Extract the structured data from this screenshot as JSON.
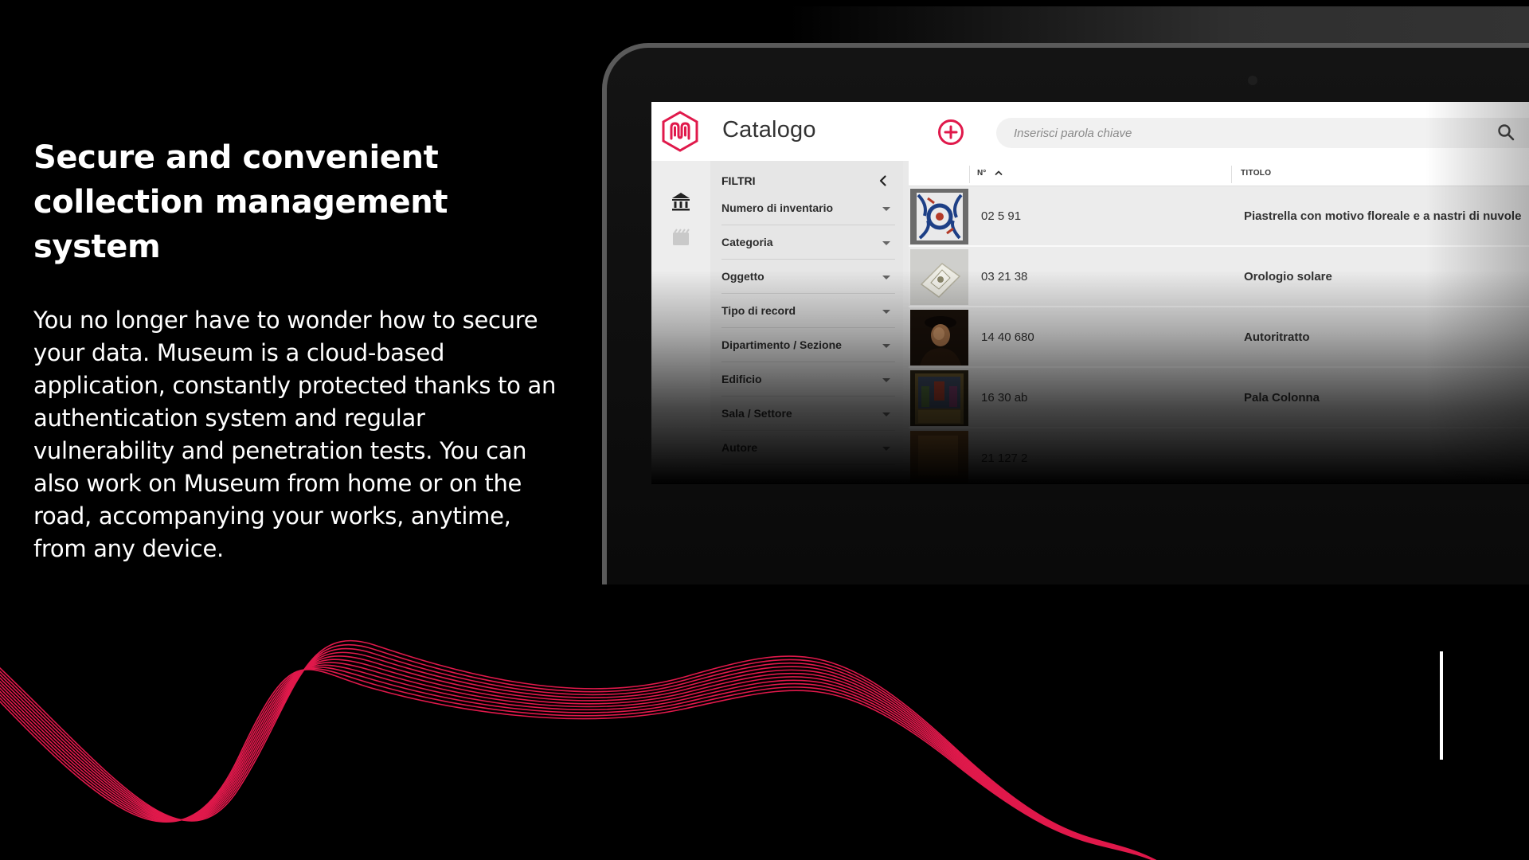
{
  "hero": {
    "title_line1": "Secure and convenient",
    "title_line2": "collection management system",
    "body": "You no longer have to wonder how to secure your data. Museum is a cloud-based application, constantly protected thanks to an authentication system and regular vulnerability and penetration tests. You can also work on Museum from home or on the road, accompanying your works, anytime, from any device."
  },
  "app": {
    "title": "Catalogo",
    "search_placeholder": "Inserisci parola chiave",
    "filters": {
      "heading": "FILTRI",
      "items": [
        "Numero di inventario",
        "Categoria",
        "Oggetto",
        "Tipo di record",
        "Dipartimento / Sezione",
        "Edificio",
        "Sala / Settore",
        "Autore"
      ]
    },
    "table": {
      "col_number": "N°",
      "col_title": "TITOLO",
      "rows": [
        {
          "number": "02 5 91",
          "title": "Piastrella con motivo floreale e a nastri di nuvole"
        },
        {
          "number": "03 21 38",
          "title": "Orologio solare"
        },
        {
          "number": "14 40 680",
          "title": "Autoritratto"
        },
        {
          "number": "16 30 ab",
          "title": "Pala Colonna"
        },
        {
          "number": "21 127 2",
          "title": ""
        }
      ]
    }
  },
  "colors": {
    "accent": "#e0194b",
    "wave": "#e0194b",
    "background": "#000000"
  },
  "icons": {
    "logo": "museum-logo-icon",
    "add": "plus-circle-icon",
    "search": "search-icon",
    "rail_1": "museum-building-icon",
    "rail_2": "film-clapper-icon",
    "collapse": "chevron-left-icon",
    "sort": "chevron-up-icon"
  }
}
